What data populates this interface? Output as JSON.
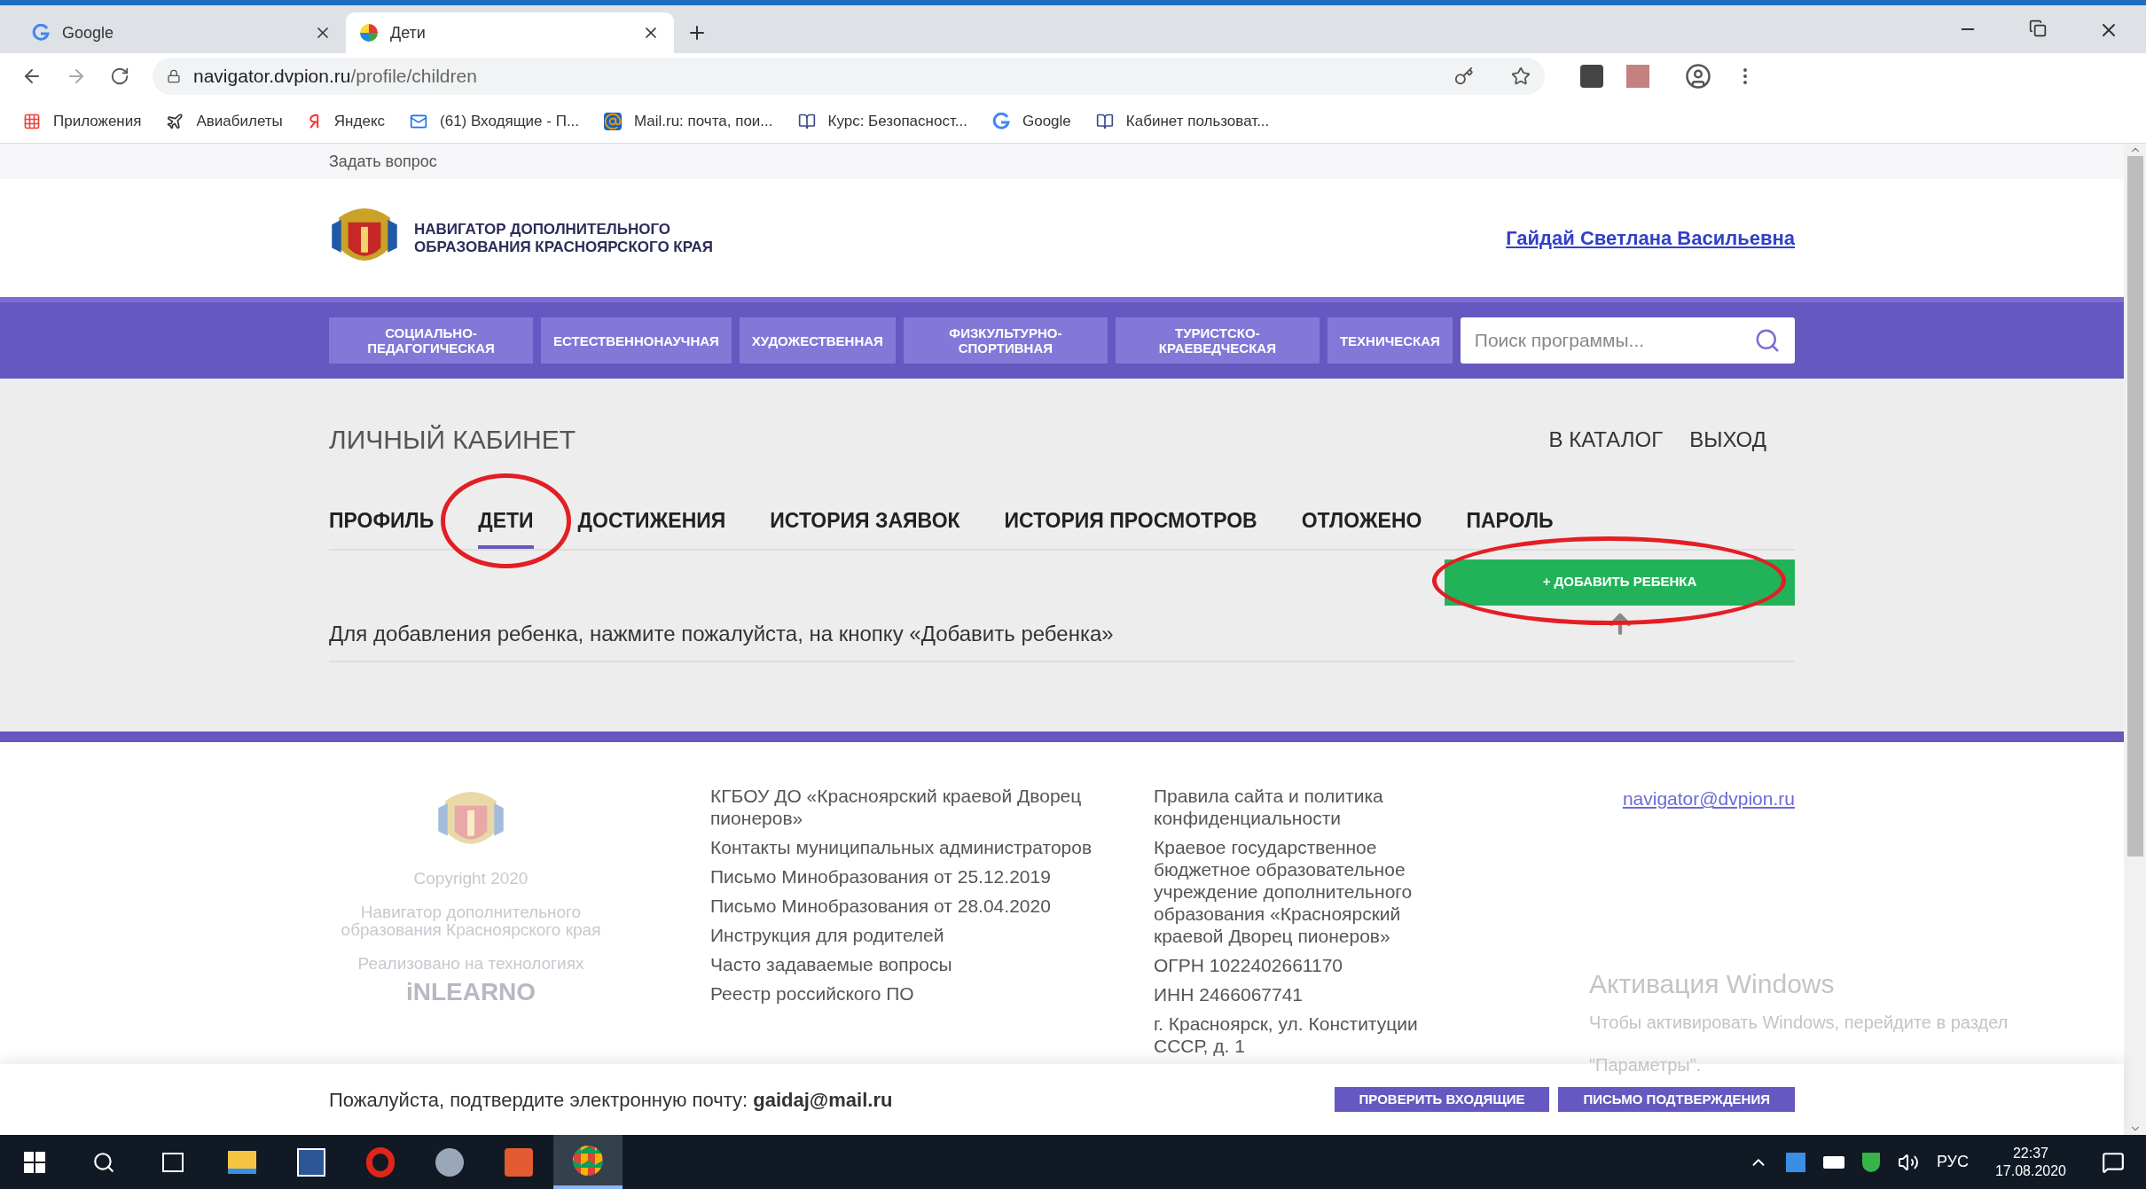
{
  "browser": {
    "tabs": [
      {
        "title": "Google",
        "selected": false
      },
      {
        "title": "Дети",
        "selected": true
      }
    ],
    "url_host": "navigator.dvpion.ru",
    "url_path": "/profile/children",
    "bookmarks": [
      "Приложения",
      "Авиабилеты",
      "Яндекс",
      "(61) Входящие - П...",
      "Mail.ru: почта, пои...",
      "Курс: Безопасност...",
      "Google",
      "Кабинет пользоват..."
    ]
  },
  "page": {
    "top_link": "Задать вопрос",
    "header": {
      "site_title_lines": [
        "НАВИГАТОР ДОПОЛНИТЕЛЬНОГО",
        "ОБРАЗОВАНИЯ КРАСНОЯРСКОГО КРАЯ"
      ],
      "user_name": "Гайдай Светлана Васильевна"
    },
    "nav": {
      "categories": [
        "СОЦИАЛЬНО-ПЕДАГОГИЧЕСКАЯ",
        "ЕСТЕСТВЕННОНАУЧНАЯ",
        "ХУДОЖЕСТВЕННАЯ",
        "ФИЗКУЛЬТУРНО-СПОРТИВНАЯ",
        "ТУРИСТСКО-КРАЕВЕДЧЕСКАЯ",
        "ТЕХНИЧЕСКАЯ"
      ],
      "search": {
        "placeholder": "Поиск программы..."
      }
    },
    "cabinet": {
      "title": "ЛИЧНЫЙ КАБИНЕТ",
      "links": [
        "В КАТАЛОГ",
        "ВЫХОД"
      ],
      "tabs": [
        {
          "label": "ПРОФИЛЬ",
          "selected": false
        },
        {
          "label": "ДЕТИ",
          "selected": true
        },
        {
          "label": "ДОСТИЖЕНИЯ",
          "selected": false
        },
        {
          "label": "ИСТОРИЯ ЗАЯВОК",
          "selected": false
        },
        {
          "label": "ИСТОРИЯ ПРОСМОТРОВ",
          "selected": false
        },
        {
          "label": "ОТЛОЖЕНО",
          "selected": false
        },
        {
          "label": "ПАРОЛЬ",
          "selected": false
        }
      ],
      "add_button": "+ ДОБАВИТЬ РЕБЕНКА",
      "hint": "Для добавления ребенка, нажмите пожалуйста, на кнопку «Добавить ребенка»"
    },
    "footer": {
      "copyright": "Copyright 2020",
      "org_name": "Навигатор дополнительного образования Красноярского края",
      "powered_by": "Реализовано на технологиях",
      "platform_logo": "iNLEARNO",
      "links": [
        "КГБОУ ДО «Красноярский краевой Дворец пионеров»",
        "Контакты муниципальных администраторов",
        "Письмо Минобразования от 25.12.2019",
        "Письмо Минобразования от 28.04.2020",
        "Инструкция для родителей",
        "Часто задаваемые вопросы",
        "Реестр российского ПО"
      ],
      "info": [
        "Правила сайта и политика конфиденциальности",
        "Краевое государственное бюджетное образовательное учреждение дополнительного образования «Красноярский краевой Дворец пионеров»",
        "ОГРН 1022402661170",
        "ИНН 2466067741",
        "г. Красноярск, ул. Конституции СССР, д. 1"
      ],
      "email": "navigator@dvpion.ru"
    },
    "confirm_bar": {
      "text": "Пожалуйста, подтвердите электронную почту: **gaidaj@mail.ru**",
      "buttons": [
        "ПРОВЕРИТЬ ВХОДЯЩИЕ",
        "ПИСЬМО ПОДТВЕРЖДЕНИЯ"
      ]
    }
  },
  "windows_activation": {
    "title": "Активация Windows",
    "text": "Чтобы активировать Windows, перейдите в раздел",
    "text_2": "\"Параметры\"."
  },
  "taskbar": {
    "language": "РУС",
    "time": "22:37",
    "date": "17.08.2020"
  }
}
